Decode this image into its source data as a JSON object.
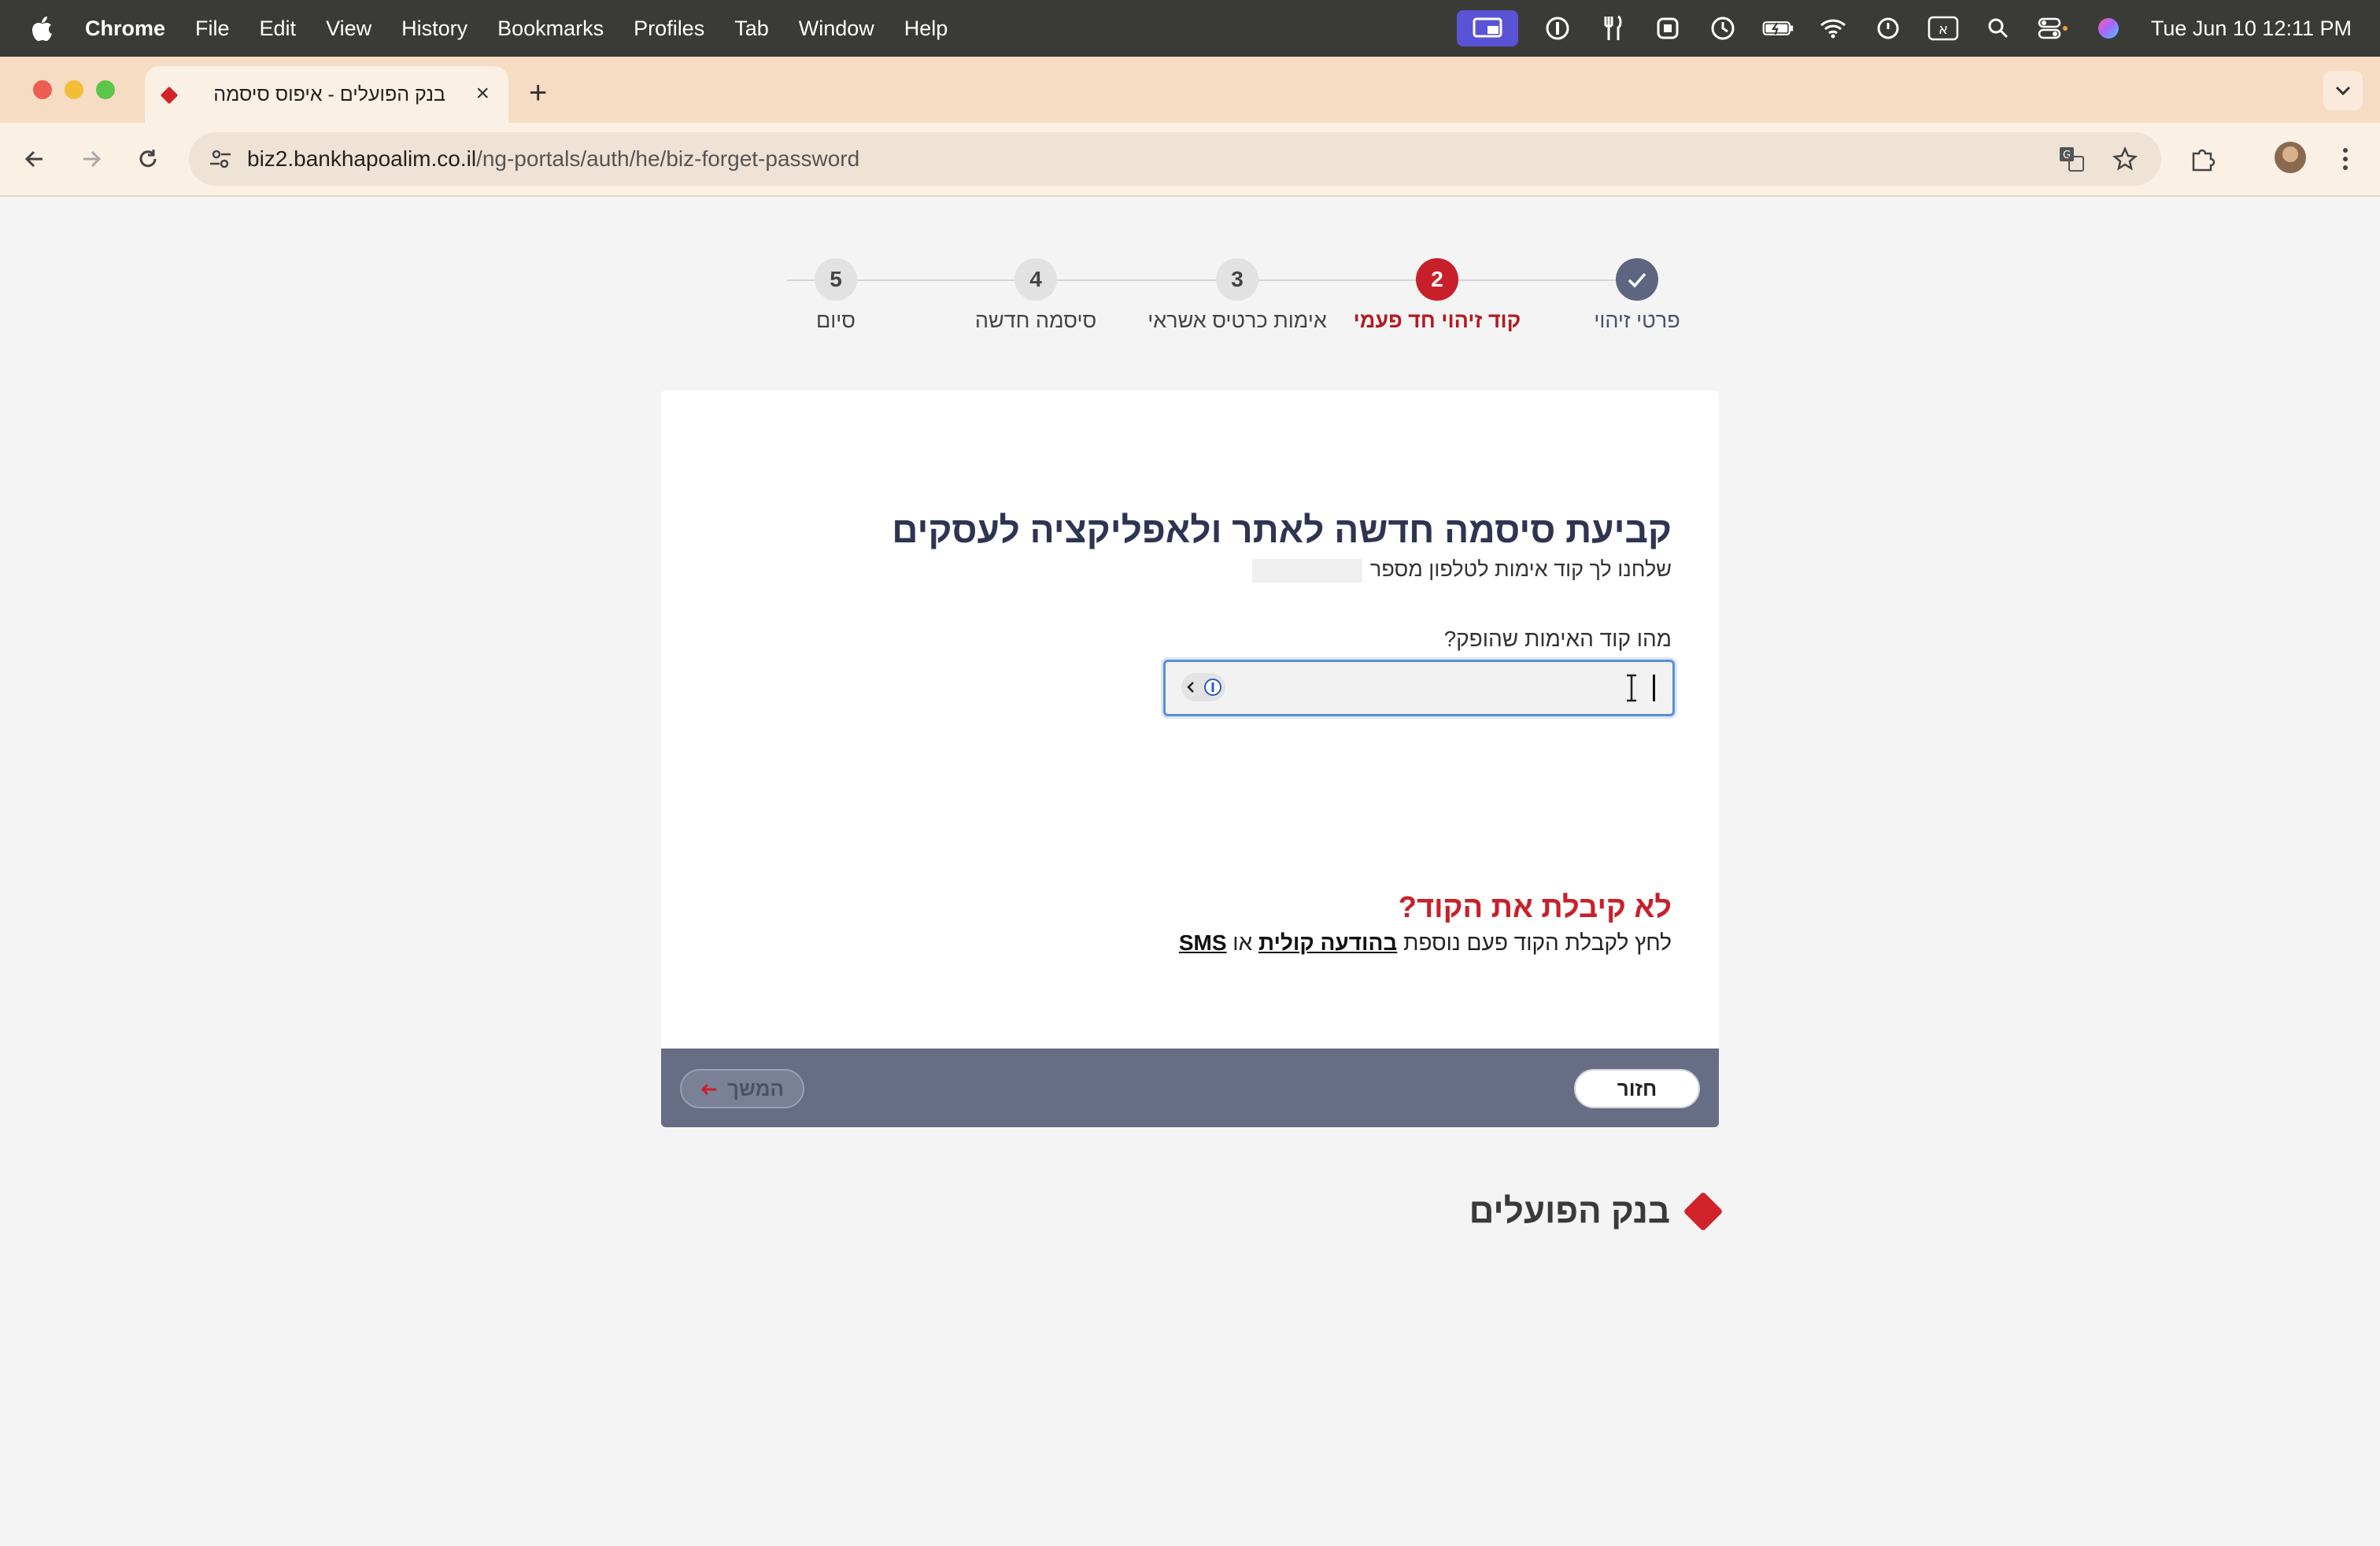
{
  "menubar": {
    "app_name": "Chrome",
    "items": [
      "File",
      "Edit",
      "View",
      "History",
      "Bookmarks",
      "Profiles",
      "Tab",
      "Window",
      "Help"
    ],
    "keyboard_layout": "א",
    "clock": "Tue Jun 10  12:11 PM"
  },
  "tab": {
    "title": "בנק הפועלים - איפוס סיסמה",
    "close": "×",
    "new_tab": "+"
  },
  "toolbar": {
    "url_host": "biz2.bankhapoalim.co.il",
    "url_path": "/ng-portals/auth/he/biz-forget-password"
  },
  "stepper": {
    "steps": [
      {
        "number": "✓",
        "label": "פרטי זיהוי",
        "state": "done"
      },
      {
        "number": "2",
        "label": "קוד זיהוי חד פעמי",
        "state": "active"
      },
      {
        "number": "3",
        "label": "אימות כרטיס אשראי",
        "state": "pending"
      },
      {
        "number": "4",
        "label": "סיסמה חדשה",
        "state": "pending"
      },
      {
        "number": "5",
        "label": "סיום",
        "state": "pending"
      }
    ]
  },
  "form": {
    "heading": "קביעת סיסמה חדשה לאתר ולאפליקציה לעסקים",
    "subtitle": "שלחנו לך קוד אימות לטלפון מספר",
    "code_label": "מהו קוד האימות שהופק?",
    "code_value": "",
    "not_received_title": "לא קיבלת את הקוד?",
    "resend_prefix": "לחץ לקבלת הקוד פעם נוספת",
    "voice_link": "בהודעה קולית",
    "or_word": "או",
    "sms_link": "SMS"
  },
  "actions": {
    "back_label": "חזור",
    "next_label": "המשך",
    "next_arrow": "➜"
  },
  "brand": {
    "name": "בנק הפועלים",
    "color": "#d2232a"
  },
  "colors": {
    "accent_red": "#c8202a",
    "done_step": "#5d6580",
    "footer_bar": "#666d84"
  }
}
